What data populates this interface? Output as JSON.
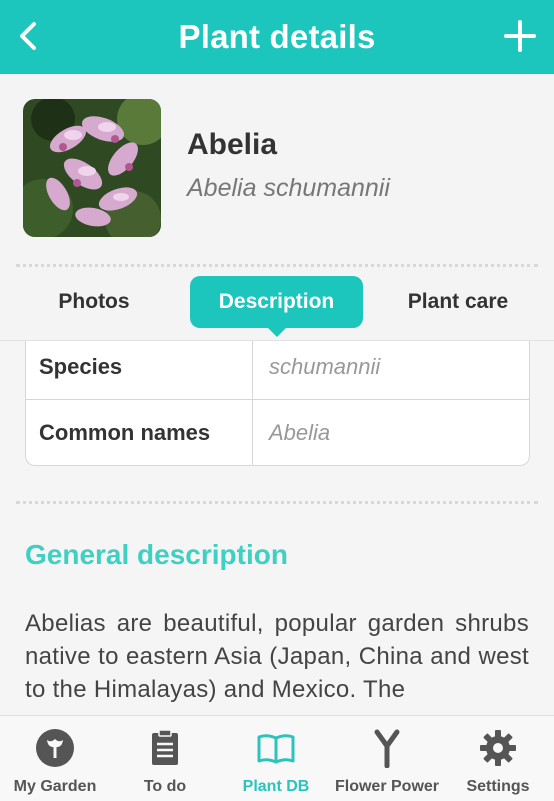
{
  "header": {
    "title": "Plant details"
  },
  "plant": {
    "name": "Abelia",
    "scientific_name": "Abelia schumannii"
  },
  "tabs": [
    {
      "label": "Photos"
    },
    {
      "label": "Description"
    },
    {
      "label": "Plant care"
    }
  ],
  "details": [
    {
      "key": "Species",
      "value": "schumannii"
    },
    {
      "key": "Common names",
      "value": "Abelia"
    }
  ],
  "general": {
    "title": "General description",
    "text": "Abelias are beautiful, popular garden shrubs native to eastern Asia (Japan, China and west to the Himalayas) and Mexico. The"
  },
  "nav": [
    {
      "label": "My Garden",
      "icon": "garden-icon"
    },
    {
      "label": "To do",
      "icon": "clipboard-icon"
    },
    {
      "label": "Plant DB",
      "icon": "book-icon"
    },
    {
      "label": "Flower Power",
      "icon": "sensor-icon"
    },
    {
      "label": "Settings",
      "icon": "gear-icon"
    }
  ],
  "colors": {
    "accent": "#1cc6bd",
    "section": "#3fcfc3"
  }
}
